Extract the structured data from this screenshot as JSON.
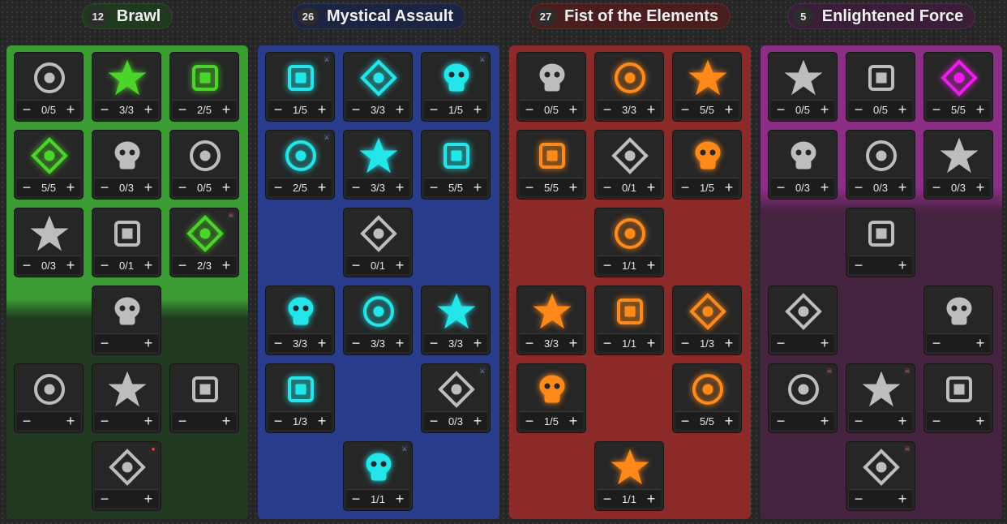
{
  "colors": {
    "brawl": "#4bd42a",
    "mystical": "#23e6ea",
    "fist": "#ff8a1a",
    "enlightened": "#ea1ee6",
    "inactive": "#bdbdbd"
  },
  "trees": [
    {
      "key": "brawl",
      "points": "12",
      "name": "Brawl",
      "nodes": [
        {
          "icon": "tree-stump-icon",
          "value": "0/5",
          "active": false
        },
        {
          "icon": "fist-burst-icon",
          "value": "3/3",
          "active": true
        },
        {
          "icon": "orb-plus-icon",
          "value": "2/5",
          "active": true
        },
        {
          "icon": "octopus-icon",
          "value": "5/5",
          "active": true
        },
        {
          "icon": "skull-cross-icon",
          "value": "0/3",
          "active": false
        },
        {
          "icon": "swirl-icon",
          "value": "0/5",
          "active": false
        },
        {
          "icon": "shield-icon",
          "value": "0/3",
          "active": false
        },
        {
          "icon": "scythe-icon",
          "value": "0/1",
          "active": false
        },
        {
          "icon": "toad-icon",
          "value": "2/3",
          "active": true,
          "badge": "skull"
        },
        {
          "icon": "drill-icon",
          "value": "",
          "active": false
        },
        {
          "icon": "gauntlet-icon",
          "value": "",
          "active": false
        },
        {
          "icon": "crossed-skull-icon",
          "value": "",
          "active": false
        },
        {
          "icon": "winged-star-icon",
          "value": "",
          "active": false
        },
        {
          "icon": "bomb-icon",
          "value": "",
          "active": false,
          "badge": "red"
        }
      ]
    },
    {
      "key": "mystical",
      "points": "26",
      "name": "Mystical Assault",
      "nodes": [
        {
          "icon": "triple-skull-icon",
          "value": "1/5",
          "active": true,
          "badge": "sword"
        },
        {
          "icon": "wing-icon",
          "value": "3/3",
          "active": true
        },
        {
          "icon": "banner-icon",
          "value": "1/5",
          "active": true,
          "badge": "sword"
        },
        {
          "icon": "arrow-curl-icon",
          "value": "2/5",
          "active": true,
          "badge": "sword"
        },
        {
          "icon": "crosshair-icon",
          "value": "3/3",
          "active": true
        },
        {
          "icon": "crystal-icon",
          "value": "5/5",
          "active": true
        },
        {
          "icon": "arrow-up-icon",
          "value": "0/1",
          "active": false
        },
        {
          "icon": "comet-icon",
          "value": "3/3",
          "active": true
        },
        {
          "icon": "rocket-skull-icon",
          "value": "3/3",
          "active": true
        },
        {
          "icon": "crossed-icon",
          "value": "3/3",
          "active": true
        },
        {
          "icon": "vortex-icon",
          "value": "1/3",
          "active": true
        },
        {
          "icon": "crowned-skull-icon",
          "value": "0/3",
          "active": false,
          "badge": "sword"
        },
        {
          "icon": "radial-icon",
          "value": "1/1",
          "active": true,
          "badge": "sword"
        }
      ]
    },
    {
      "key": "fist",
      "points": "27",
      "name": "Fist of the Elements",
      "nodes": [
        {
          "icon": "hourglass-icon",
          "value": "0/5",
          "active": false
        },
        {
          "icon": "target-fist-icon",
          "value": "3/3",
          "active": true
        },
        {
          "icon": "chains-icon",
          "value": "5/5",
          "active": true
        },
        {
          "icon": "fire-skull-icon",
          "value": "5/5",
          "active": true
        },
        {
          "icon": "bag-icon",
          "value": "0/1",
          "active": false
        },
        {
          "icon": "twin-skull-icon",
          "value": "1/5",
          "active": true
        },
        {
          "icon": "gauntlet-skull-icon",
          "value": "1/1",
          "active": true
        },
        {
          "icon": "lightning-icon",
          "value": "3/3",
          "active": true
        },
        {
          "icon": "brick-icon",
          "value": "1/1",
          "active": true
        },
        {
          "icon": "mushroom-skull-icon",
          "value": "1/3",
          "active": true
        },
        {
          "icon": "heart-icon",
          "value": "1/5",
          "active": true
        },
        {
          "icon": "serpent-icon",
          "value": "5/5",
          "active": true
        },
        {
          "icon": "pistol-icon",
          "value": "1/1",
          "active": true
        }
      ]
    },
    {
      "key": "enlightened",
      "points": "5",
      "name": "Enlightened Force",
      "nodes": [
        {
          "icon": "crest-icon",
          "value": "0/5",
          "active": false
        },
        {
          "icon": "clenched-fist-icon",
          "value": "0/5",
          "active": false
        },
        {
          "icon": "bird-icon",
          "value": "5/5",
          "active": true
        },
        {
          "icon": "bottle-icon",
          "value": "0/3",
          "active": false
        },
        {
          "icon": "shell-icon",
          "value": "0/3",
          "active": false
        },
        {
          "icon": "fist-plus-icon",
          "value": "0/3",
          "active": false
        },
        {
          "icon": "fist-aura-icon",
          "value": "",
          "active": false
        },
        {
          "icon": "fist-up-icon",
          "value": "",
          "active": false
        },
        {
          "icon": "face-icon",
          "value": "",
          "active": false
        },
        {
          "icon": "sword-splash-icon",
          "value": "",
          "active": false,
          "badge": "skull"
        },
        {
          "icon": "shards-icon",
          "value": "",
          "active": false,
          "badge": "skull"
        },
        {
          "icon": "nova-icon",
          "value": "",
          "active": false
        },
        {
          "icon": "tendril-icon",
          "value": "",
          "active": false,
          "badge": "skull"
        }
      ]
    }
  ]
}
